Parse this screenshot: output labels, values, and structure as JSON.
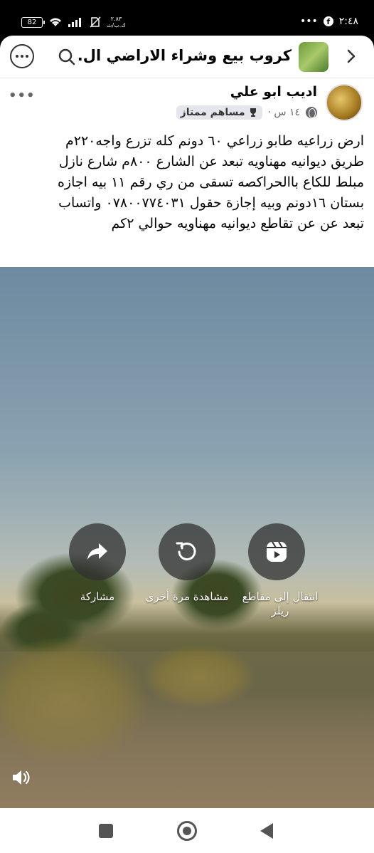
{
  "status_bar": {
    "battery": "82",
    "speed_top": "٢.٨٣",
    "speed_bottom": "ك.ب/ث",
    "more": "•••",
    "time": "٢:٤٨"
  },
  "topbar": {
    "back_icon": "chevron-right-icon",
    "title": "كروب بيع وشراء الاراضي ال..",
    "search_icon": "search-icon",
    "more_icon": "more-dots-icon"
  },
  "post": {
    "author": "اديب ابو علي",
    "badge": "مساهم ممتاز",
    "time": "١٤ س ·",
    "menu": "•••",
    "text_lines": [
      "ارض زراعيه  طابو زراعي  ٦٠ دونم كله تزرع  واجه٢٢٠م",
      "طريق ديوانيه مهناويه تبعد عن الشارع ٨٠٠م شارع نازل",
      "مبلط للكاع  باالحراكصه  تسقى من ري رقم ١١ بيه اجازه",
      "بستان ١٦دونم وبيه إجازة حقول  ٠٧٨٠٠٧٧٤٠٣١ واتساب",
      "تبعد عن عن تقاطع ديوانيه مهناويه حوالي ٢كم"
    ]
  },
  "video": {
    "actions": {
      "reels_label": "انتقال إلى مقاطع ريلز",
      "replay_label": "مشاهدة مرة أخرى",
      "share_label": "مشاركة"
    }
  },
  "colors": {
    "accent": "#1877f2",
    "text": "#050505",
    "muted": "#65676b"
  }
}
